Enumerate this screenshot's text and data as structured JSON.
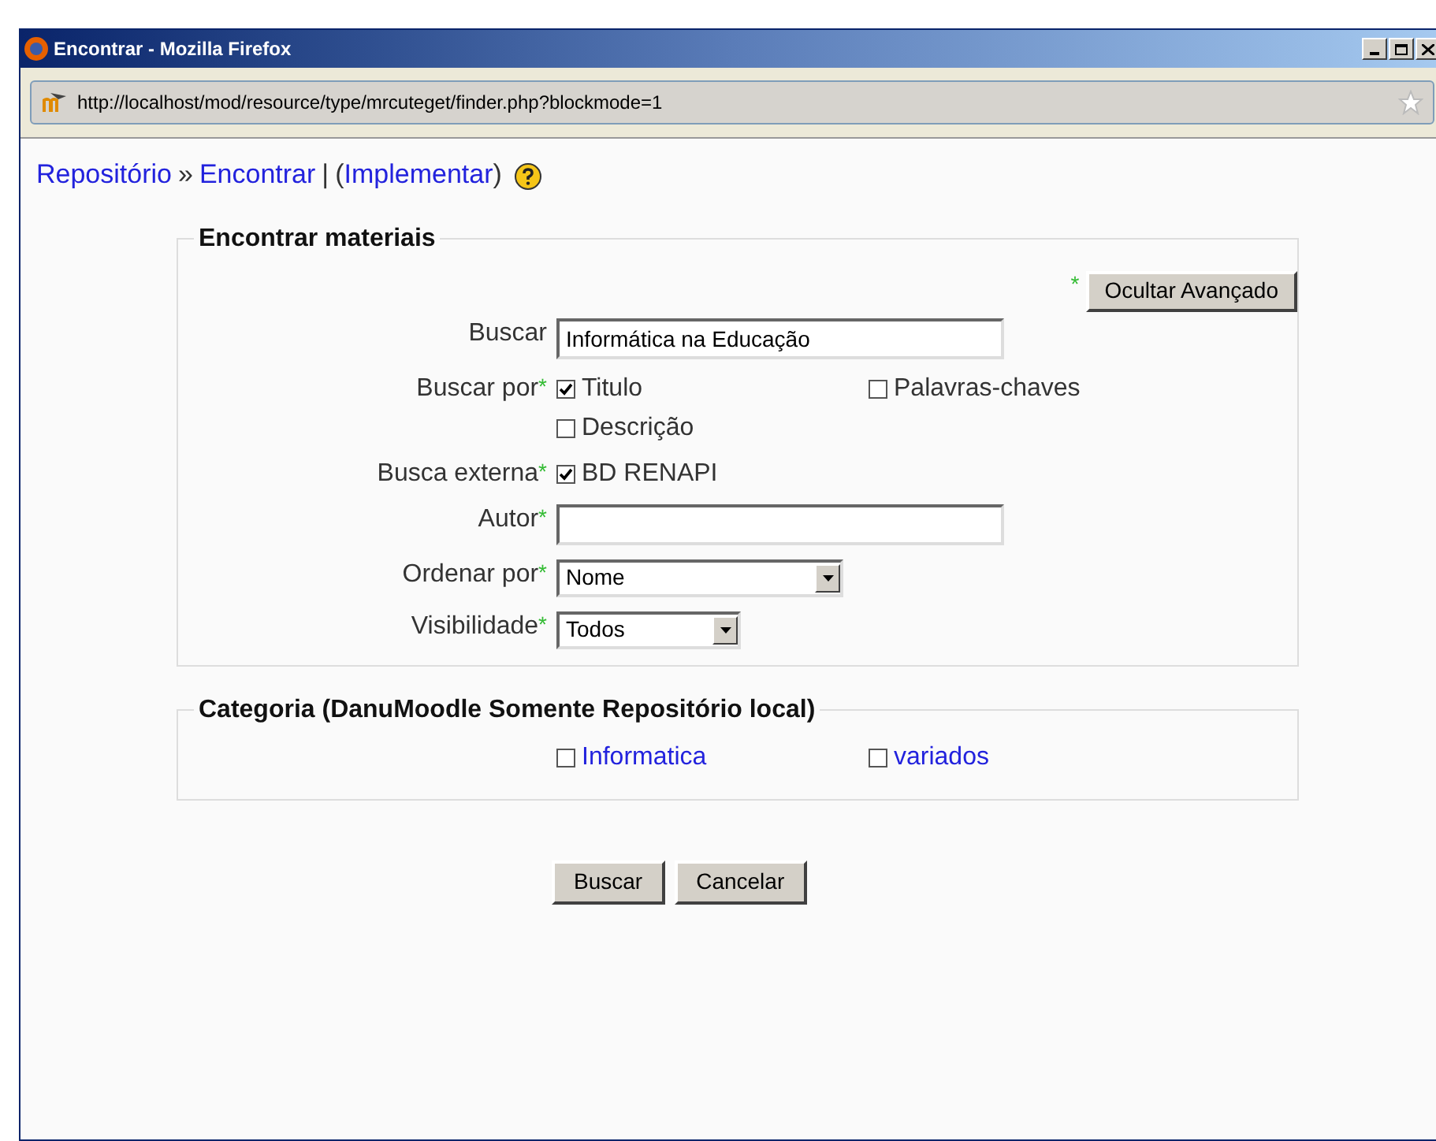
{
  "window": {
    "title": "Encontrar - Mozilla Firefox"
  },
  "address_bar": {
    "url": "http://localhost/mod/resource/type/mrcuteget/finder.php?blockmode=1"
  },
  "breadcrumb": [
    {
      "kind": "link",
      "text": "Repositório"
    },
    {
      "kind": "text",
      "text": "»"
    },
    {
      "kind": "link",
      "text": "Encontrar"
    },
    {
      "kind": "text",
      "text": "|"
    },
    {
      "kind": "text",
      "text": "("
    },
    {
      "kind": "link",
      "text": "Implementar"
    },
    {
      "kind": "text",
      "text": ")"
    }
  ],
  "search_section": {
    "title": "Encontrar materiais",
    "advanced_button": {
      "label": "Ocultar Avançado",
      "mark": "*"
    },
    "fields": [
      {
        "kind": "text",
        "label": "Buscar",
        "value": "Informática na Educação"
      },
      {
        "kind": "checkboxes",
        "label": "Buscar por",
        "mark": "*",
        "options": [
          {
            "label": "Titulo",
            "checked": true
          },
          {
            "label": "Palavras-chaves",
            "checked": false
          },
          {
            "label": "Descrição",
            "checked": false
          }
        ]
      },
      {
        "kind": "checkboxes",
        "label": "Busca externa",
        "mark": "*",
        "options": [
          {
            "label": "BD RENAPI",
            "checked": true
          }
        ]
      },
      {
        "kind": "text",
        "label": "Autor",
        "mark": "*"
      },
      {
        "kind": "select",
        "label": "Ordenar por",
        "mark": "*",
        "value": "Nome"
      },
      {
        "kind": "select",
        "label": "Visibilidade",
        "mark": "*",
        "value": "Todos"
      }
    ]
  },
  "category_section": {
    "title": "Categoria (DanuMoodle Somente Repositório local)",
    "options": [
      {
        "label": "Informatica",
        "checked": false
      },
      {
        "label": "variados",
        "checked": false
      }
    ]
  },
  "buttons": [
    "Buscar",
    "Cancelar"
  ]
}
